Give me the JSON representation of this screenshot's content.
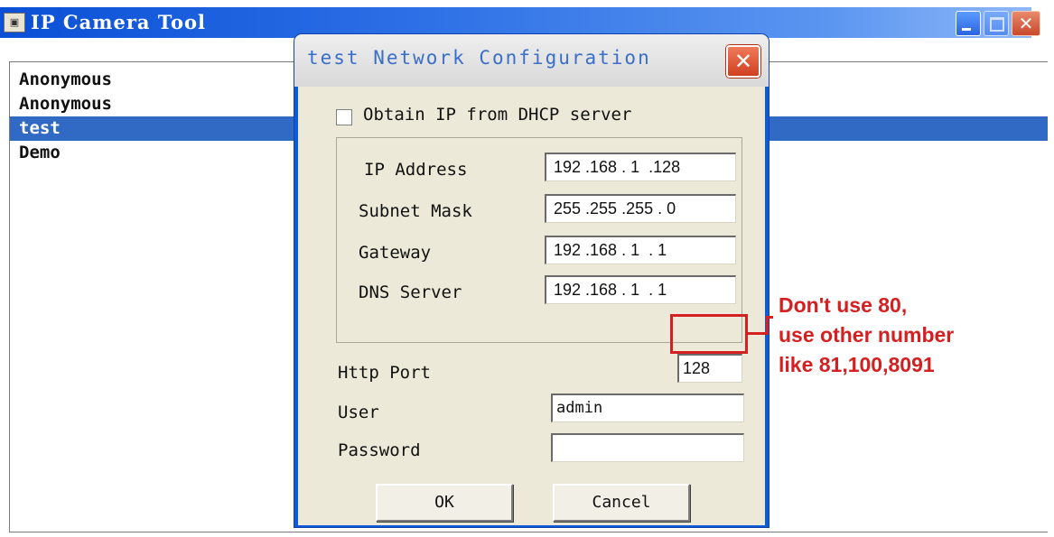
{
  "main_window": {
    "title": "IP Camera Tool",
    "icon": "app-camera-icon",
    "camera_list": [
      {
        "name": "Anonymous",
        "selected": false
      },
      {
        "name": "Anonymous",
        "selected": false
      },
      {
        "name": "test",
        "selected": true
      },
      {
        "name": "Demo",
        "selected": false
      }
    ]
  },
  "dialog": {
    "title": "test Network Configuration",
    "dhcp": {
      "label": "Obtain IP from DHCP server",
      "checked": false
    },
    "fields": {
      "ip_address": {
        "label": "IP Address",
        "value": "192 .168 . 1  .128"
      },
      "subnet_mask": {
        "label": "Subnet Mask",
        "value": "255 .255 .255 . 0"
      },
      "gateway": {
        "label": "Gateway",
        "value": "192 .168 . 1  . 1"
      },
      "dns_server": {
        "label": "DNS Server",
        "value": "192 .168 . 1  . 1"
      },
      "http_port": {
        "label": "Http Port",
        "value": "128"
      },
      "user": {
        "label": "User",
        "value": "admin"
      },
      "password": {
        "label": "Password",
        "value": ""
      }
    },
    "buttons": {
      "ok": "OK",
      "cancel": "Cancel"
    }
  },
  "annotation": {
    "lines": [
      "Don't use 80,",
      "use other number",
      "like 81,100,8091"
    ],
    "color": "#d42020"
  },
  "colors": {
    "titlebar_blue": "#0a50d6",
    "selection": "#316ac5",
    "dialog_bg": "#ece9d8"
  }
}
